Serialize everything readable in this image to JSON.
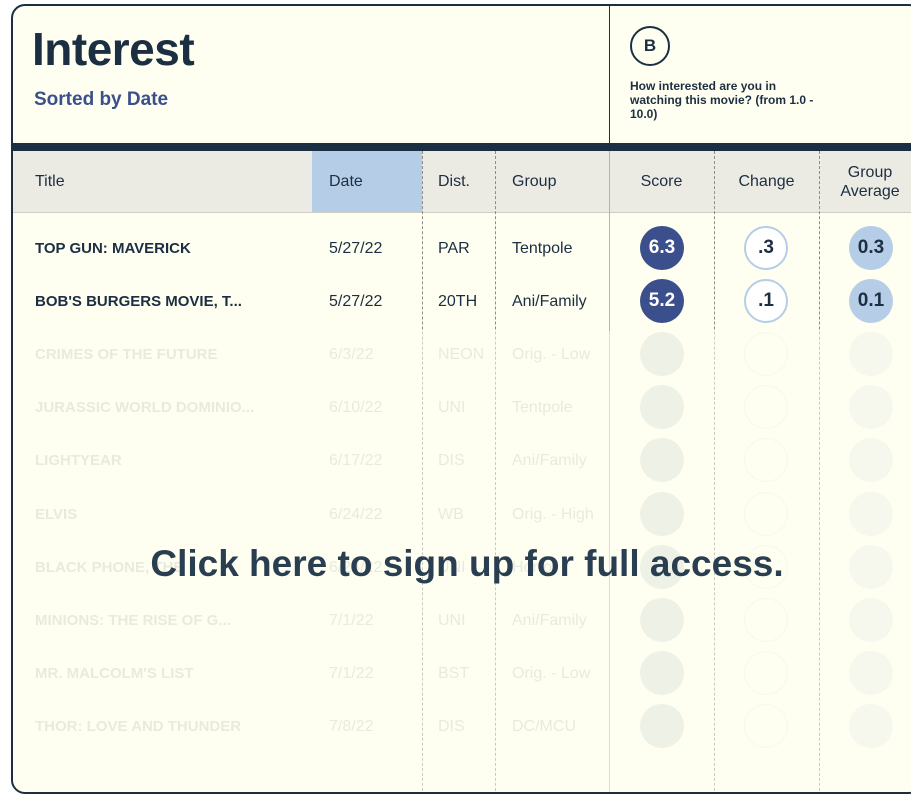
{
  "header": {
    "title": "Interest",
    "subtitle": "Sorted by Date",
    "badge": "B",
    "question": "How interested are you in watching this movie? (from 1.0 - 10.0)"
  },
  "columns": {
    "title": "Title",
    "date": "Date",
    "dist": "Dist.",
    "group": "Group",
    "score": "Score",
    "change": "Change",
    "group_average": "Group Average"
  },
  "rows": [
    {
      "title": "TOP GUN: MAVERICK",
      "date": "5/27/22",
      "dist": "PAR",
      "group": "Tentpole",
      "score": "6.3",
      "change": ".3",
      "avg": "0.3",
      "locked": false
    },
    {
      "title": "BOB'S BURGERS MOVIE, T...",
      "date": "5/27/22",
      "dist": "20TH",
      "group": "Ani/Family",
      "score": "5.2",
      "change": ".1",
      "avg": "0.1",
      "locked": false
    },
    {
      "title": "CRIMES OF THE FUTURE",
      "date": "6/3/22",
      "dist": "NEON",
      "group": "Orig. - Low",
      "score": "",
      "change": "",
      "avg": "",
      "locked": true
    },
    {
      "title": "JURASSIC WORLD DOMINIO...",
      "date": "6/10/22",
      "dist": "UNI",
      "group": "Tentpole",
      "score": "",
      "change": "",
      "avg": "",
      "locked": true
    },
    {
      "title": "LIGHTYEAR",
      "date": "6/17/22",
      "dist": "DIS",
      "group": "Ani/Family",
      "score": "",
      "change": "",
      "avg": "",
      "locked": true
    },
    {
      "title": "ELVIS",
      "date": "6/24/22",
      "dist": "WB",
      "group": "Orig. - High",
      "score": "",
      "change": "",
      "avg": "",
      "locked": true
    },
    {
      "title": "BLACK PHONE, THE",
      "date": "6/24/22",
      "dist": "UNI",
      "group": "Horror",
      "score": "",
      "change": "",
      "avg": "",
      "locked": true
    },
    {
      "title": "MINIONS: THE RISE OF G...",
      "date": "7/1/22",
      "dist": "UNI",
      "group": "Ani/Family",
      "score": "",
      "change": "",
      "avg": "",
      "locked": true
    },
    {
      "title": "MR. MALCOLM'S LIST",
      "date": "7/1/22",
      "dist": "BST",
      "group": "Orig. - Low",
      "score": "",
      "change": "",
      "avg": "",
      "locked": true
    },
    {
      "title": "THOR: LOVE AND THUNDER",
      "date": "7/8/22",
      "dist": "DIS",
      "group": "DC/MCU",
      "score": "",
      "change": "",
      "avg": "",
      "locked": true
    }
  ],
  "cta": "Click here to sign up for full access.",
  "colors": {
    "navy": "#1c2e42",
    "score_fill": "#3a4f8c",
    "accent_light_blue": "#b6cde7",
    "background": "#fefff0"
  }
}
